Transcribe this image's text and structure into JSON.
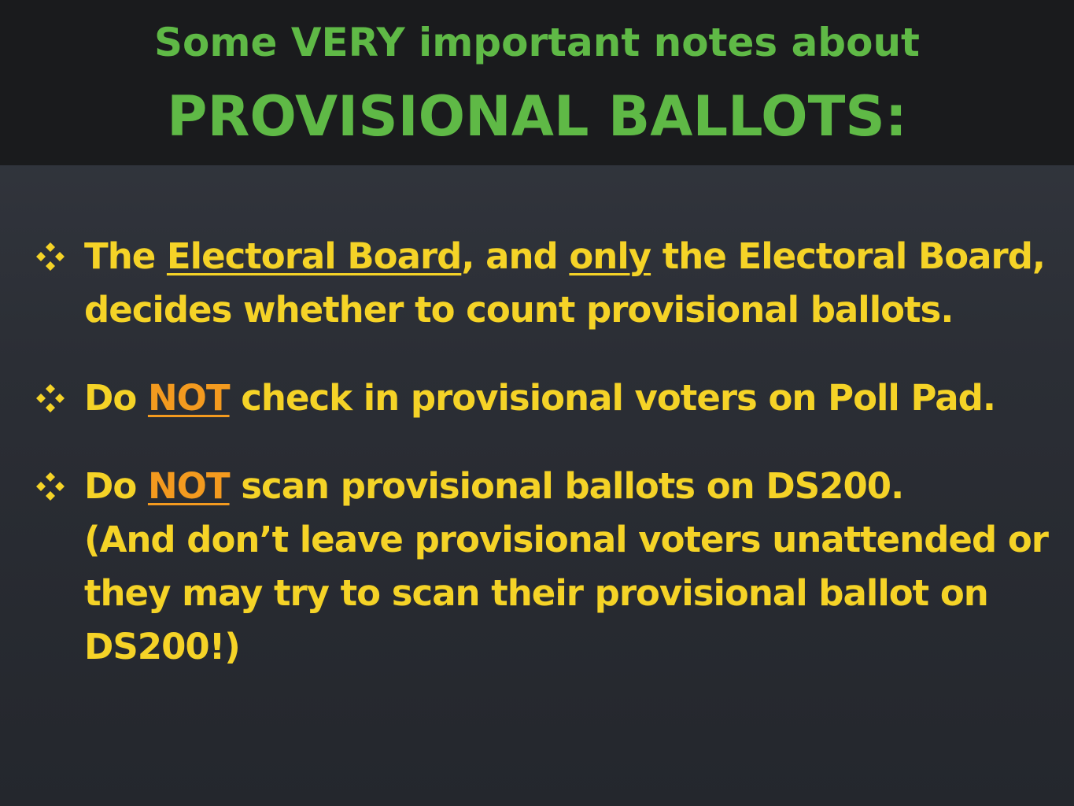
{
  "header": {
    "title_line1": "Some VERY important notes about",
    "title_line2": "PROVISIONAL BALLOTS:"
  },
  "bullets": [
    {
      "bullet_icon": "four-diamond-icon",
      "p1": "The ",
      "u1": "Electoral Board",
      "p2": ", and ",
      "u2": "only",
      "p3": " the Electoral Board, decides whether to count provisional ballots."
    },
    {
      "bullet_icon": "four-diamond-icon",
      "p1": "Do ",
      "u1": "NOT",
      "p2": " check in provisional voters on Poll Pad."
    },
    {
      "bullet_icon": "four-diamond-icon",
      "p1": "Do ",
      "u1": "NOT",
      "p2": " scan provisional ballots on DS200.",
      "line2": "(And don’t leave provisional voters unattended or they may try to scan their provisional ballot on DS200!)"
    }
  ],
  "colors": {
    "background": "#2a2d33",
    "header_background": "#1a1b1d",
    "title": "#5fb946",
    "bullet_text": "#f5d327",
    "emphasis": "#f39a1f"
  }
}
